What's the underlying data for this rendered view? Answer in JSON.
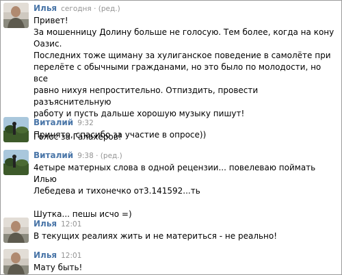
{
  "messages": [
    {
      "author": "Илья",
      "time": "сегодня · (ред.)",
      "text": "Привет!\nЗа мошенницу Долину больше не голосую. Тем более, когда на кону Оазис.\nПоследних тоже щиману за хулиганское поведение в самолёте при\nперелёте с обычными гражданами, но это было по молодости, но все\nравно нихуя непростительно. Отпиздить, провести разъяснительную\nработу и пусть дальше хорошую музыку пишут!\n\nГолос за Галахеров!"
    },
    {
      "author": "Виталий",
      "time": "9:32",
      "text": "Принято, спасибо за участие в опросе))"
    },
    {
      "author": "Виталий",
      "time": "9:38 · (ред.)",
      "text": "4етыре матерных слова в одной рецензии... повелеваю поймать Илью\nЛебедева и тихонечко от3.141592...ть\n\nШутка... пешы исчо =)"
    },
    {
      "author": "Илья",
      "time": "12:01",
      "text": "В текущих реалиях жить и не материться - не реально!"
    },
    {
      "author": "Илья",
      "time": "12:01",
      "text": "Мату быть!"
    }
  ],
  "colors": {
    "author": "#4a76a8",
    "time": "#939393",
    "text": "#000000",
    "border": "#9a9a9a"
  }
}
